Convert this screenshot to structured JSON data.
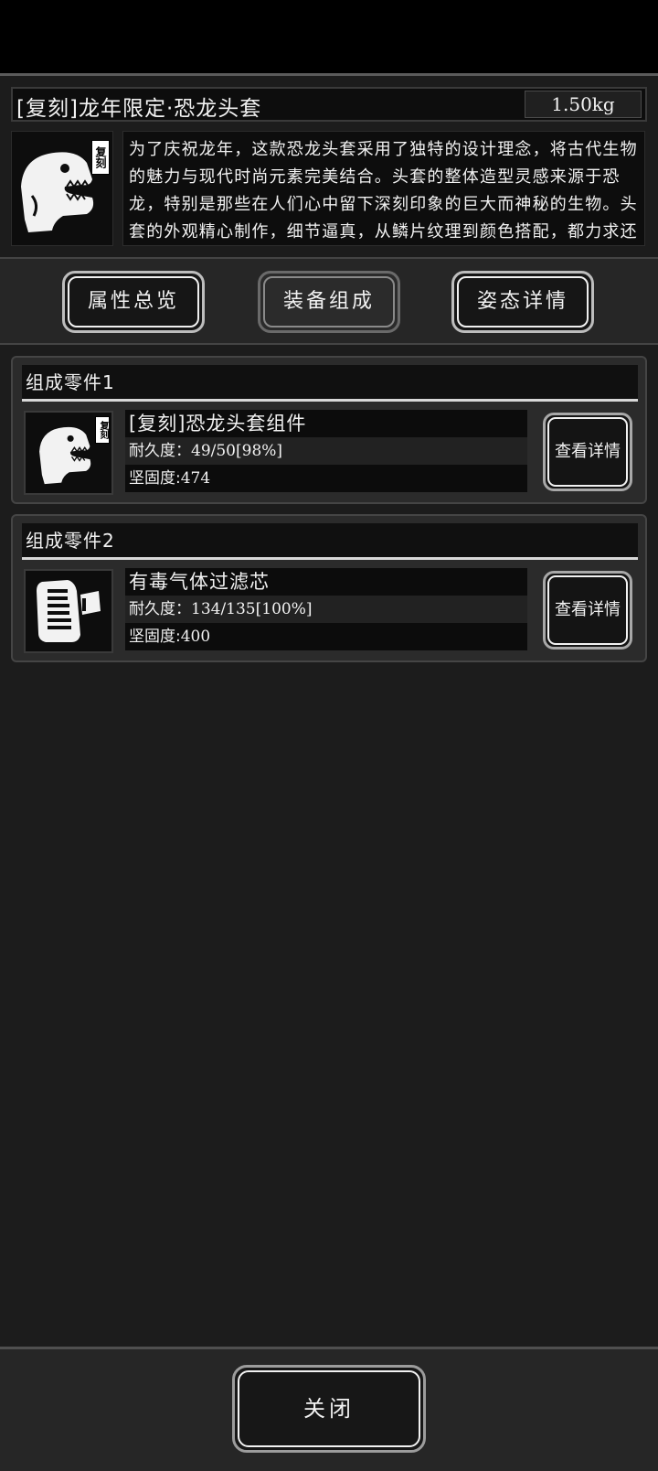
{
  "item": {
    "title": "[复刻]龙年限定·恐龙头套",
    "weight": "1.50kg",
    "tag": "复刻",
    "description": "为了庆祝龙年，这款恐龙头套采用了独特的设计理念，将古代生物的魅力与现代时尚元素完美结合。头套的整体造型灵感来源于恐龙，特别是那些在人们心中留下深刻印象的巨大而神秘的生物。头套的外观精心制作，细节逼真，从鳞片纹理到颜色搭配，都力求还原，全套完整现龙头部形象，色彩上以深绿和浅蓝色为"
  },
  "tabs": [
    {
      "label": "属性总览",
      "active": false
    },
    {
      "label": "装备组成",
      "active": true
    },
    {
      "label": "姿态详情",
      "active": false
    }
  ],
  "parts": [
    {
      "section_title": "组成零件1",
      "name": "[复刻]恐龙头套组件",
      "durability_label": "耐久度：",
      "durability_value": "49/50[98%]",
      "hardness_label": "坚固度:",
      "hardness_value": "474",
      "tag": "复刻",
      "icon": "dinosaur-head-icon",
      "detail_label": "查看详情"
    },
    {
      "section_title": "组成零件2",
      "name": "有毒气体过滤芯",
      "durability_label": "耐久度：",
      "durability_value": "134/135[100%]",
      "hardness_label": "坚固度:",
      "hardness_value": "400",
      "icon": "filter-cartridge-icon",
      "detail_label": "查看详情"
    }
  ],
  "close_label": "关闭",
  "colors": {
    "background": "#1c1c1c",
    "accent": "#f2f2f2",
    "topbar": "#000000"
  }
}
